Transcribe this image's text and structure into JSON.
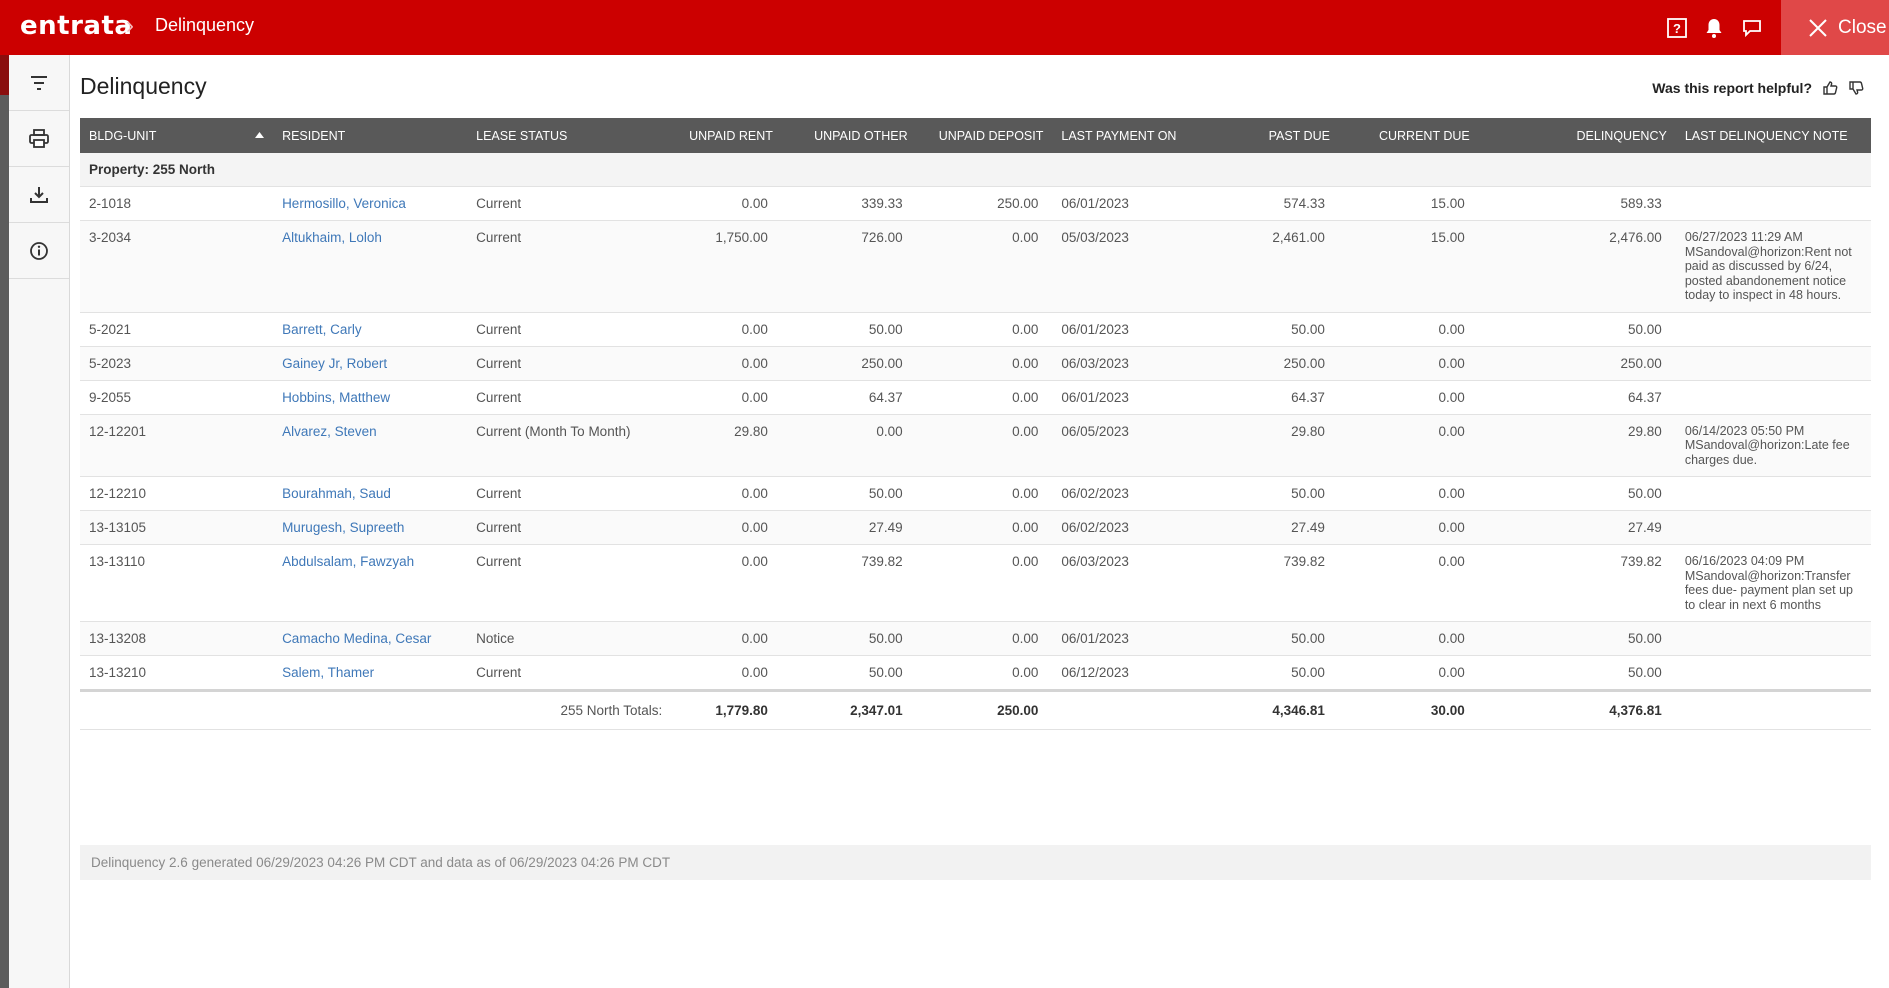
{
  "header": {
    "logo": "entrata",
    "breadcrumb": "Delinquency",
    "close_label": "Close"
  },
  "page": {
    "title": "Delinquency",
    "helpful_prompt": "Was this report helpful?"
  },
  "table": {
    "columns": [
      "BLDG-UNIT",
      "RESIDENT",
      "LEASE STATUS",
      "UNPAID RENT",
      "UNPAID OTHER",
      "UNPAID DEPOSIT",
      "LAST PAYMENT ON",
      "PAST DUE",
      "CURRENT DUE",
      "DELINQUENCY",
      "LAST DELINQUENCY NOTE"
    ],
    "property_label": "Property: 255 North",
    "rows": [
      {
        "unit": "2-1018",
        "resident": "Hermosillo, Veronica",
        "status": "Current",
        "unpaid_rent": "0.00",
        "unpaid_other": "339.33",
        "unpaid_deposit": "250.00",
        "last_payment": "06/01/2023",
        "past_due": "574.33",
        "current_due": "15.00",
        "delinquency": "589.33",
        "note": ""
      },
      {
        "unit": "3-2034",
        "resident": "Altukhaim, Loloh",
        "status": "Current",
        "unpaid_rent": "1,750.00",
        "unpaid_other": "726.00",
        "unpaid_deposit": "0.00",
        "last_payment": "05/03/2023",
        "past_due": "2,461.00",
        "current_due": "15.00",
        "delinquency": "2,476.00",
        "note": "06/27/2023 11:29 AM MSandoval@horizon:Rent not paid as discussed by 6/24, posted abandonement notice today to inspect in 48 hours."
      },
      {
        "unit": "5-2021",
        "resident": "Barrett, Carly",
        "status": "Current",
        "unpaid_rent": "0.00",
        "unpaid_other": "50.00",
        "unpaid_deposit": "0.00",
        "last_payment": "06/01/2023",
        "past_due": "50.00",
        "current_due": "0.00",
        "delinquency": "50.00",
        "note": ""
      },
      {
        "unit": "5-2023",
        "resident": "Gainey Jr, Robert",
        "status": "Current",
        "unpaid_rent": "0.00",
        "unpaid_other": "250.00",
        "unpaid_deposit": "0.00",
        "last_payment": "06/03/2023",
        "past_due": "250.00",
        "current_due": "0.00",
        "delinquency": "250.00",
        "note": ""
      },
      {
        "unit": "9-2055",
        "resident": "Hobbins, Matthew",
        "status": "Current",
        "unpaid_rent": "0.00",
        "unpaid_other": "64.37",
        "unpaid_deposit": "0.00",
        "last_payment": "06/01/2023",
        "past_due": "64.37",
        "current_due": "0.00",
        "delinquency": "64.37",
        "note": ""
      },
      {
        "unit": "12-12201",
        "resident": "Alvarez, Steven",
        "status": "Current (Month To Month)",
        "unpaid_rent": "29.80",
        "unpaid_other": "0.00",
        "unpaid_deposit": "0.00",
        "last_payment": "06/05/2023",
        "past_due": "29.80",
        "current_due": "0.00",
        "delinquency": "29.80",
        "note": "06/14/2023 05:50 PM MSandoval@horizon:Late fee charges due."
      },
      {
        "unit": "12-12210",
        "resident": "Bourahmah, Saud",
        "status": "Current",
        "unpaid_rent": "0.00",
        "unpaid_other": "50.00",
        "unpaid_deposit": "0.00",
        "last_payment": "06/02/2023",
        "past_due": "50.00",
        "current_due": "0.00",
        "delinquency": "50.00",
        "note": ""
      },
      {
        "unit": "13-13105",
        "resident": "Murugesh, Supreeth",
        "status": "Current",
        "unpaid_rent": "0.00",
        "unpaid_other": "27.49",
        "unpaid_deposit": "0.00",
        "last_payment": "06/02/2023",
        "past_due": "27.49",
        "current_due": "0.00",
        "delinquency": "27.49",
        "note": ""
      },
      {
        "unit": "13-13110",
        "resident": "Abdulsalam, Fawzyah",
        "status": "Current",
        "unpaid_rent": "0.00",
        "unpaid_other": "739.82",
        "unpaid_deposit": "0.00",
        "last_payment": "06/03/2023",
        "past_due": "739.82",
        "current_due": "0.00",
        "delinquency": "739.82",
        "note": "06/16/2023 04:09 PM MSandoval@horizon:Transfer fees due- payment plan set up to clear in next 6 months"
      },
      {
        "unit": "13-13208",
        "resident": "Camacho Medina, Cesar",
        "status": "Notice",
        "unpaid_rent": "0.00",
        "unpaid_other": "50.00",
        "unpaid_deposit": "0.00",
        "last_payment": "06/01/2023",
        "past_due": "50.00",
        "current_due": "0.00",
        "delinquency": "50.00",
        "note": ""
      },
      {
        "unit": "13-13210",
        "resident": "Salem, Thamer",
        "status": "Current",
        "unpaid_rent": "0.00",
        "unpaid_other": "50.00",
        "unpaid_deposit": "0.00",
        "last_payment": "06/12/2023",
        "past_due": "50.00",
        "current_due": "0.00",
        "delinquency": "50.00",
        "note": ""
      }
    ],
    "totals": {
      "label": "255 North Totals:",
      "unpaid_rent": "1,779.80",
      "unpaid_other": "2,347.01",
      "unpaid_deposit": "250.00",
      "past_due": "4,346.81",
      "current_due": "30.00",
      "delinquency": "4,376.81"
    }
  },
  "footer": {
    "generated_text": "Delinquency 2.6 generated 06/29/2023 04:26 PM CDT and data as of 06/29/2023 04:26 PM CDT"
  },
  "icons": {
    "help": "help-icon",
    "notifications": "bell-icon",
    "chat": "chat-icon",
    "close": "close-icon",
    "filter": "filter-icon",
    "print": "print-icon",
    "download": "download-icon",
    "info": "info-icon",
    "thumbs_up": "thumbs-up-icon",
    "thumbs_down": "thumbs-down-icon",
    "sort": "sort-up-icon"
  },
  "colors": {
    "brand": "#cc0000",
    "link": "#3f78b8",
    "header_bg": "#595959"
  }
}
